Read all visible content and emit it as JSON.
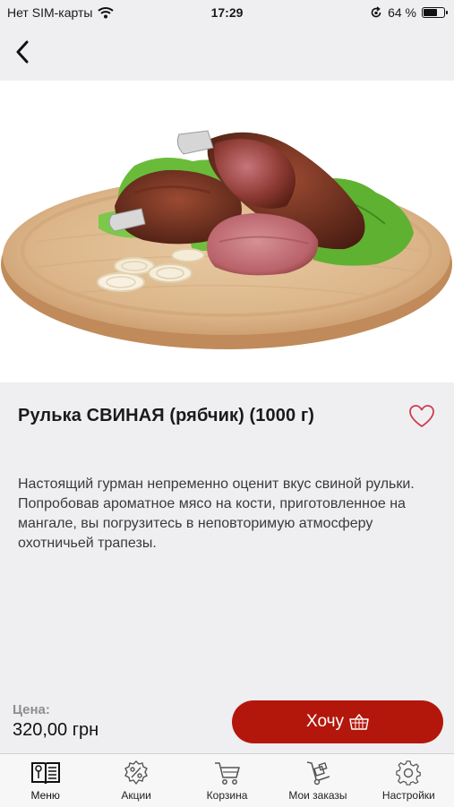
{
  "status_bar": {
    "carrier": "Нет SIM-карты",
    "time": "17:29",
    "battery": "64 %",
    "battery_level": 0.64
  },
  "product": {
    "title": "Рулька СВИНАЯ (рябчик) (1000 г)",
    "description": "Настоящий гурман непременно оценит вкус свиной рульки. Попробовав ароматное мясо на кости, приготовленное на мангале, вы погрузитесь в неповторимую атмосферу охотничьей трапезы.",
    "price_label": "Цена:",
    "price": "320,00 грн",
    "buy_label": "Хочу"
  },
  "colors": {
    "accent": "#b3170c",
    "heart": "#d23b4e",
    "background": "#efeff1"
  },
  "tabs": [
    {
      "label": "Меню",
      "icon": "menu-book-icon",
      "active": true
    },
    {
      "label": "Акции",
      "icon": "percent-badge-icon"
    },
    {
      "label": "Корзина",
      "icon": "cart-icon"
    },
    {
      "label": "Мои заказы",
      "icon": "hand-truck-icon"
    },
    {
      "label": "Настройки",
      "icon": "gear-icon"
    }
  ]
}
